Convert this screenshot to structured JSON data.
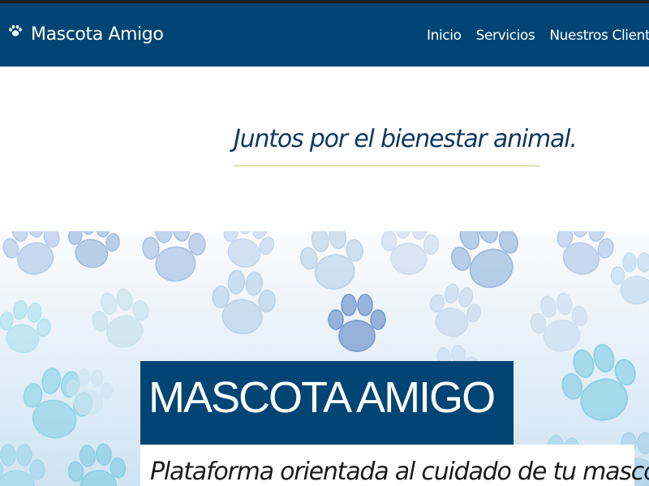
{
  "navbar": {
    "brand_name": "Mascota Amigo",
    "brand_icon": "paw-icon",
    "links": [
      {
        "label": "Inicio"
      },
      {
        "label": "Servicios"
      },
      {
        "label": "Nuestros Clientes"
      }
    ]
  },
  "intro": {
    "tagline": "Juntos por el bienestar animal."
  },
  "hero": {
    "title": "MASCOTA AMIGO",
    "subtitle": "Plataforma orientada al cuidado de tu mascota."
  },
  "colors": {
    "nav_bg": "#004573",
    "accent_line": "#e0bf64",
    "tagline_text": "#10385e"
  }
}
